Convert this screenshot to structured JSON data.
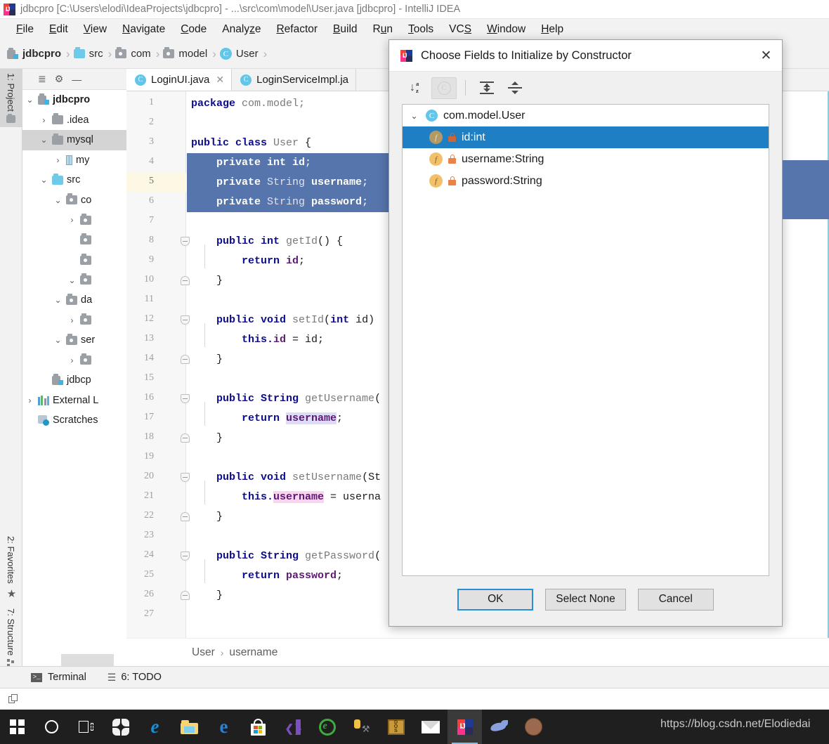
{
  "window": {
    "title": "jdbcpro [C:\\Users\\elodi\\IdeaProjects\\jdbcpro] - ...\\src\\com\\model\\User.java [jdbcpro] - IntelliJ IDEA",
    "app_logo_text": "IJ"
  },
  "menubar": {
    "items": [
      {
        "label": "File",
        "mnemonic": "F"
      },
      {
        "label": "Edit",
        "mnemonic": "E"
      },
      {
        "label": "View",
        "mnemonic": "V"
      },
      {
        "label": "Navigate",
        "mnemonic": "N"
      },
      {
        "label": "Code",
        "mnemonic": "C"
      },
      {
        "label": "Analyze",
        "mnemonic": "z"
      },
      {
        "label": "Refactor",
        "mnemonic": "R"
      },
      {
        "label": "Build",
        "mnemonic": "B"
      },
      {
        "label": "Run",
        "mnemonic": "u"
      },
      {
        "label": "Tools",
        "mnemonic": "T"
      },
      {
        "label": "VCS",
        "mnemonic": "S"
      },
      {
        "label": "Window",
        "mnemonic": "W"
      },
      {
        "label": "Help",
        "mnemonic": "H"
      }
    ]
  },
  "navbar": {
    "crumbs": [
      {
        "label": "jdbcpro",
        "icon": "module-icon",
        "bold": true
      },
      {
        "label": "src",
        "icon": "source-folder-icon",
        "bold": false
      },
      {
        "label": "com",
        "icon": "package-icon",
        "bold": false
      },
      {
        "label": "model",
        "icon": "package-icon",
        "bold": false
      },
      {
        "label": "User",
        "icon": "class-icon",
        "bold": false
      }
    ],
    "separator": "›"
  },
  "rail": {
    "top": [
      {
        "label": "1: Project",
        "active": true
      }
    ],
    "bottom": [
      {
        "label": "2: Favorites",
        "active": false
      },
      {
        "label": "7: Structure",
        "active": false
      }
    ]
  },
  "project_panel": {
    "header_icons": [
      "collapse-all-icon",
      "settings-gear-icon",
      "hide-icon"
    ],
    "tree": [
      {
        "label": "jdbcpro",
        "indent": 0,
        "arrow": "⌄",
        "icon": "module-icon",
        "bold": true,
        "selected": false
      },
      {
        "label": ".idea",
        "indent": 1,
        "arrow": "›",
        "icon": "folder-icon",
        "bold": false,
        "selected": false
      },
      {
        "label": "mysql",
        "indent": 1,
        "arrow": "⌄",
        "icon": "folder-icon",
        "bold": false,
        "selected": true
      },
      {
        "label": "my",
        "indent": 2,
        "arrow": "›",
        "icon": "jar-icon",
        "bold": false,
        "selected": false
      },
      {
        "label": "src",
        "indent": 1,
        "arrow": "⌄",
        "icon": "source-folder-icon",
        "bold": false,
        "selected": false
      },
      {
        "label": "co",
        "indent": 2,
        "arrow": "⌄",
        "icon": "package-icon",
        "bold": false,
        "selected": false
      },
      {
        "label": "",
        "indent": 3,
        "arrow": "›",
        "icon": "package-icon",
        "bold": false,
        "selected": false
      },
      {
        "label": "",
        "indent": 3,
        "arrow": "",
        "icon": "package-icon",
        "bold": false,
        "selected": false
      },
      {
        "label": "",
        "indent": 3,
        "arrow": "",
        "icon": "package-icon",
        "bold": false,
        "selected": false
      },
      {
        "label": "",
        "indent": 3,
        "arrow": "⌄",
        "icon": "package-icon",
        "bold": false,
        "selected": false
      },
      {
        "label": "da",
        "indent": 2,
        "arrow": "⌄",
        "icon": "package-icon",
        "bold": false,
        "selected": false
      },
      {
        "label": "",
        "indent": 3,
        "arrow": "›",
        "icon": "package-icon",
        "bold": false,
        "selected": false
      },
      {
        "label": "ser",
        "indent": 2,
        "arrow": "⌄",
        "icon": "package-icon",
        "bold": false,
        "selected": false
      },
      {
        "label": "",
        "indent": 3,
        "arrow": "›",
        "icon": "package-icon",
        "bold": false,
        "selected": false
      },
      {
        "label": "jdbcp",
        "indent": 1,
        "arrow": "",
        "icon": "module-icon",
        "bold": false,
        "selected": false
      },
      {
        "label": "External L",
        "indent": 0,
        "arrow": "›",
        "icon": "external-libraries-icon",
        "bold": false,
        "selected": false
      },
      {
        "label": "Scratches",
        "indent": 0,
        "arrow": "",
        "icon": "scratches-icon",
        "bold": false,
        "selected": false
      }
    ]
  },
  "editor": {
    "tabs": [
      {
        "label": "LoginUI.java",
        "icon": "class-icon",
        "active": true,
        "closable": true
      },
      {
        "label": "LoginServiceImpl.ja",
        "icon": "class-icon",
        "active": false,
        "closable": false
      }
    ],
    "current_line": 5,
    "lines": [
      {
        "n": 1,
        "tokens": [
          {
            "t": "package ",
            "c": "kw"
          },
          {
            "t": "com.model;",
            "c": "id"
          }
        ]
      },
      {
        "n": 2,
        "tokens": []
      },
      {
        "n": 3,
        "tokens": [
          {
            "t": "public class ",
            "c": "kw"
          },
          {
            "t": "User ",
            "c": "id"
          },
          {
            "t": "{",
            "c": "pln"
          }
        ]
      },
      {
        "n": 4,
        "selected": true,
        "tokens": [
          {
            "t": "    private int ",
            "c": "kw"
          },
          {
            "t": "id",
            "c": "fld"
          },
          {
            "t": ";",
            "c": "pln"
          }
        ]
      },
      {
        "n": 5,
        "selected": true,
        "tokens": [
          {
            "t": "    private ",
            "c": "kw"
          },
          {
            "t": "String ",
            "c": "id"
          },
          {
            "t": "username",
            "c": "fld"
          },
          {
            "t": ";",
            "c": "pln"
          }
        ]
      },
      {
        "n": 6,
        "selected": true,
        "tokens": [
          {
            "t": "    private ",
            "c": "kw"
          },
          {
            "t": "String ",
            "c": "id"
          },
          {
            "t": "password",
            "c": "fld"
          },
          {
            "t": ";",
            "c": "pln"
          }
        ]
      },
      {
        "n": 7,
        "tokens": []
      },
      {
        "n": 8,
        "fold": "open",
        "tokens": [
          {
            "t": "    public int ",
            "c": "kw"
          },
          {
            "t": "getId",
            "c": "id"
          },
          {
            "t": "() {",
            "c": "pln"
          }
        ]
      },
      {
        "n": 9,
        "tokens": [
          {
            "t": "        return ",
            "c": "kw"
          },
          {
            "t": "id",
            "c": "fld"
          },
          {
            "t": ";",
            "c": "pln"
          }
        ]
      },
      {
        "n": 10,
        "fold": "close",
        "tokens": [
          {
            "t": "    }",
            "c": "pln"
          }
        ]
      },
      {
        "n": 11,
        "tokens": []
      },
      {
        "n": 12,
        "fold": "open",
        "tokens": [
          {
            "t": "    public void ",
            "c": "kw"
          },
          {
            "t": "setId",
            "c": "id"
          },
          {
            "t": "(",
            "c": "pln"
          },
          {
            "t": "int ",
            "c": "kw"
          },
          {
            "t": "id",
            "c": "pln"
          },
          {
            "t": ")",
            "c": "pln"
          }
        ]
      },
      {
        "n": 13,
        "tokens": [
          {
            "t": "        this.",
            "c": "kw"
          },
          {
            "t": "id",
            "c": "fld"
          },
          {
            "t": " = id;",
            "c": "pln"
          }
        ]
      },
      {
        "n": 14,
        "fold": "close",
        "tokens": [
          {
            "t": "    }",
            "c": "pln"
          }
        ]
      },
      {
        "n": 15,
        "tokens": []
      },
      {
        "n": 16,
        "fold": "open",
        "tokens": [
          {
            "t": "    public String ",
            "c": "kw"
          },
          {
            "t": "getUsername",
            "c": "id"
          },
          {
            "t": "(",
            "c": "pln"
          }
        ]
      },
      {
        "n": 17,
        "tokens": [
          {
            "t": "        return ",
            "c": "kw"
          },
          {
            "t": "username",
            "c": "fld",
            "hl": "read"
          },
          {
            "t": ";",
            "c": "pln"
          }
        ]
      },
      {
        "n": 18,
        "fold": "close",
        "tokens": [
          {
            "t": "    }",
            "c": "pln"
          }
        ]
      },
      {
        "n": 19,
        "tokens": []
      },
      {
        "n": 20,
        "fold": "open",
        "tokens": [
          {
            "t": "    public void ",
            "c": "kw"
          },
          {
            "t": "setUsername",
            "c": "id"
          },
          {
            "t": "(St",
            "c": "pln"
          }
        ]
      },
      {
        "n": 21,
        "tokens": [
          {
            "t": "        this.",
            "c": "kw"
          },
          {
            "t": "username",
            "c": "fld",
            "hl": "write"
          },
          {
            "t": " = userna",
            "c": "pln"
          }
        ]
      },
      {
        "n": 22,
        "fold": "close",
        "tokens": [
          {
            "t": "    }",
            "c": "pln"
          }
        ]
      },
      {
        "n": 23,
        "tokens": []
      },
      {
        "n": 24,
        "fold": "open",
        "tokens": [
          {
            "t": "    public String ",
            "c": "kw"
          },
          {
            "t": "getPassword",
            "c": "id"
          },
          {
            "t": "(",
            "c": "pln"
          }
        ]
      },
      {
        "n": 25,
        "tokens": [
          {
            "t": "        return ",
            "c": "kw"
          },
          {
            "t": "password",
            "c": "fld"
          },
          {
            "t": ";",
            "c": "pln"
          }
        ]
      },
      {
        "n": 26,
        "fold": "close",
        "tokens": [
          {
            "t": "    }",
            "c": "pln"
          }
        ]
      },
      {
        "n": 27,
        "tokens": []
      }
    ],
    "breadcrumb": {
      "class": "User",
      "member": "username",
      "separator": "›"
    }
  },
  "dialog": {
    "title": "Choose Fields to Initialize by Constructor",
    "close_label": "✕",
    "toolbar": [
      {
        "name": "sort-alphabetically-icon",
        "enabled": true
      },
      {
        "name": "c-toggle-icon",
        "enabled": false
      },
      {
        "name": "expand-all-icon",
        "enabled": true
      },
      {
        "name": "collapse-all-icon",
        "enabled": true
      }
    ],
    "tree": [
      {
        "label": "com.model.User",
        "type": "class",
        "arrow": "⌄",
        "selected": false,
        "locked": false
      },
      {
        "label": "id:int",
        "type": "field",
        "arrow": "",
        "selected": true,
        "locked": true
      },
      {
        "label": "username:String",
        "type": "field",
        "arrow": "",
        "selected": false,
        "locked": true
      },
      {
        "label": "password:String",
        "type": "field",
        "arrow": "",
        "selected": false,
        "locked": true
      }
    ],
    "buttons": [
      {
        "label": "OK",
        "default": true
      },
      {
        "label": "Select None",
        "default": false
      },
      {
        "label": "Cancel",
        "default": false
      }
    ]
  },
  "statusbar": {
    "items": [
      {
        "label": "Terminal",
        "icon": "terminal-icon",
        "mnemonic": ""
      },
      {
        "label": "6: TODO",
        "icon": "todo-list-icon",
        "mnemonic": "6"
      }
    ]
  },
  "taskbar": {
    "items": [
      {
        "name": "start-button",
        "icon": "windows-logo-icon"
      },
      {
        "name": "cortana-search",
        "icon": "cortana-circle-icon"
      },
      {
        "name": "task-view",
        "icon": "task-view-icon"
      },
      {
        "name": "pinwheel-app",
        "icon": "pinwheel-icon"
      },
      {
        "name": "internet-explorer",
        "icon": "ie-icon"
      },
      {
        "name": "file-explorer",
        "icon": "folder-explorer-icon"
      },
      {
        "name": "microsoft-edge",
        "icon": "edge-icon"
      },
      {
        "name": "microsoft-store",
        "icon": "store-icon"
      },
      {
        "name": "visual-studio-code",
        "icon": "vscode-icon"
      },
      {
        "name": "green-browser",
        "icon": "green-browser-icon"
      },
      {
        "name": "db-tools",
        "icon": "db-tools-icon"
      },
      {
        "name": "dosbox",
        "icon": "dosbox-icon"
      },
      {
        "name": "mail-app",
        "icon": "mail-icon"
      },
      {
        "name": "intellij-idea",
        "icon": "intellij-icon",
        "active": true
      },
      {
        "name": "navicat",
        "icon": "dolphin-icon"
      },
      {
        "name": "user-avatar",
        "icon": "avatar-icon"
      }
    ]
  },
  "watermark": {
    "text": "https://blog.csdn.net/Elodiedai"
  },
  "colors": {
    "selection_blue": "#5675ac",
    "dialog_selection": "#1f7fc4",
    "accent_cyan": "#63c6e8",
    "current_line": "#fcf8e3",
    "taskbar_bg": "#1f1f1f"
  }
}
